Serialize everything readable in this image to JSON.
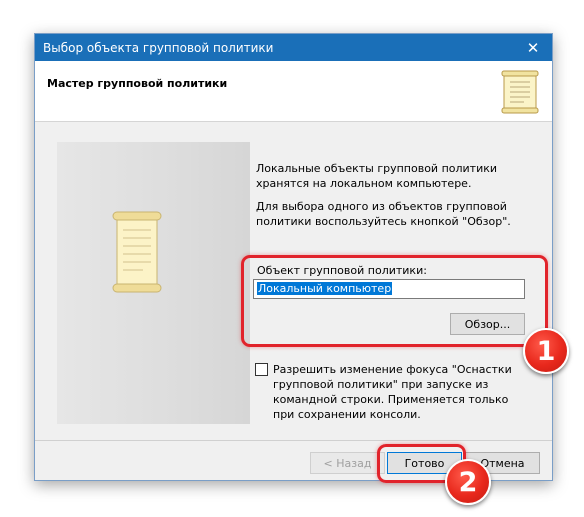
{
  "window": {
    "title": "Выбор объекта групповой политики",
    "close_glyph": "✕"
  },
  "header": {
    "title": "Мастер групповой политики",
    "icon": "scroll-icon"
  },
  "description": {
    "line1": "Локальные объекты групповой политики хранятся на локальном компьютере.",
    "line2": "Для выбора одного из объектов групповой политики воспользуйтесь кнопкой \"Обзор\"."
  },
  "gpo_field": {
    "label": "Объект групповой политики:",
    "value": "Локальный компьютер"
  },
  "browse_button": "Обзор...",
  "checkbox": {
    "checked": false,
    "label": "Разрешить изменение фокуса \"Оснастки групповой политики\" при запуске из командной строки. Применяется только при сохранении консоли."
  },
  "footer": {
    "back_label": "< Назад",
    "finish_label": "Готово",
    "cancel_label": "Отмена"
  },
  "annotations": {
    "badge1": "1",
    "badge2": "2",
    "highlight_color": "#e1232b"
  }
}
